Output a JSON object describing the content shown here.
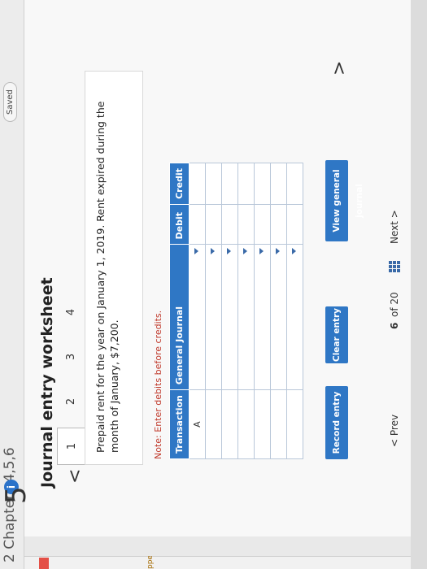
{
  "header": {
    "chapter": "2 Chapters 4,5,6",
    "info_badge": "i",
    "saved": "Saved"
  },
  "sidebar": {
    "label": "pped"
  },
  "worksheet": {
    "big_letter": "5",
    "title": "Journal entry worksheet",
    "nav_prev": "<",
    "nav_next": ">",
    "tabs": [
      {
        "label": "1",
        "active": true
      },
      {
        "label": "2",
        "active": false
      },
      {
        "label": "3",
        "active": false
      },
      {
        "label": "4",
        "active": false
      }
    ],
    "prompt": "Prepaid rent for the year on January 1, 2019. Rent expired during the month of January, $7,200.",
    "note": "Note: Enter debits before credits.",
    "table": {
      "headers": [
        "Transaction",
        "General Journal",
        "Debit",
        "Credit"
      ],
      "first_row_transaction": "A"
    }
  },
  "buttons": {
    "record": "Record entry",
    "clear": "Clear entry",
    "view": "View general journal"
  },
  "pager": {
    "prev": "< Prev",
    "position": "6",
    "of": "of 20",
    "next": "Next >"
  },
  "colors": {
    "accent": "#2f77c5",
    "note": "#c0392b",
    "badge": "#2a72c9"
  }
}
